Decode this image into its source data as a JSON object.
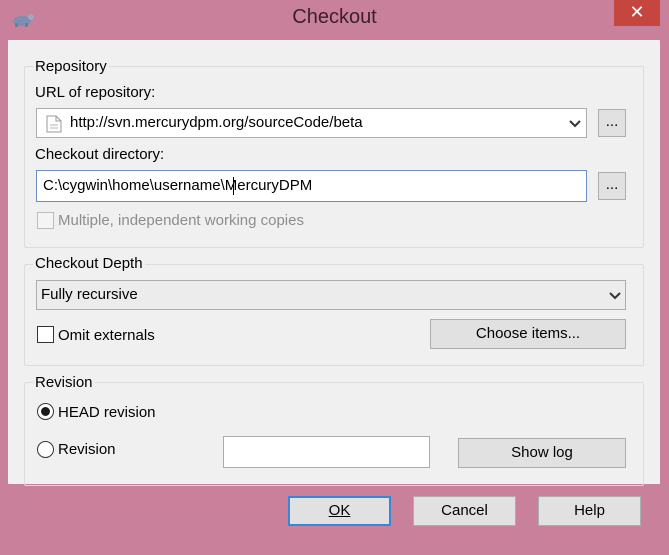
{
  "window": {
    "title": "Checkout",
    "close_glyph": "✕",
    "app_icon": "tortoise-app-icon"
  },
  "repository": {
    "group_label": "Repository",
    "url_label": "URL of repository:",
    "url_value": "http://svn.mercurydpm.org/sourceCode/beta",
    "url_browse_label": "...",
    "dir_label": "Checkout directory:",
    "dir_value": "C:\\cygwin\\home\\username\\MercuryDPM",
    "dir_browse_label": "...",
    "multiple_label": "Multiple, independent working copies",
    "multiple_checked": false,
    "multiple_enabled": false
  },
  "depth": {
    "group_label": "Checkout Depth",
    "selected": "Fully recursive",
    "omit_label": "Omit externals",
    "omit_checked": false,
    "choose_label": "Choose items..."
  },
  "revision": {
    "group_label": "Revision",
    "head_label": "HEAD revision",
    "head_selected": true,
    "rev_label": "Revision",
    "rev_value": "",
    "show_log_label": "Show log"
  },
  "buttons": {
    "ok": "OK",
    "cancel": "Cancel",
    "help": "Help"
  },
  "colors": {
    "frame": "#c9809a",
    "client": "#f0f0f0",
    "close": "#c5463f",
    "focus": "#3a86d6"
  }
}
